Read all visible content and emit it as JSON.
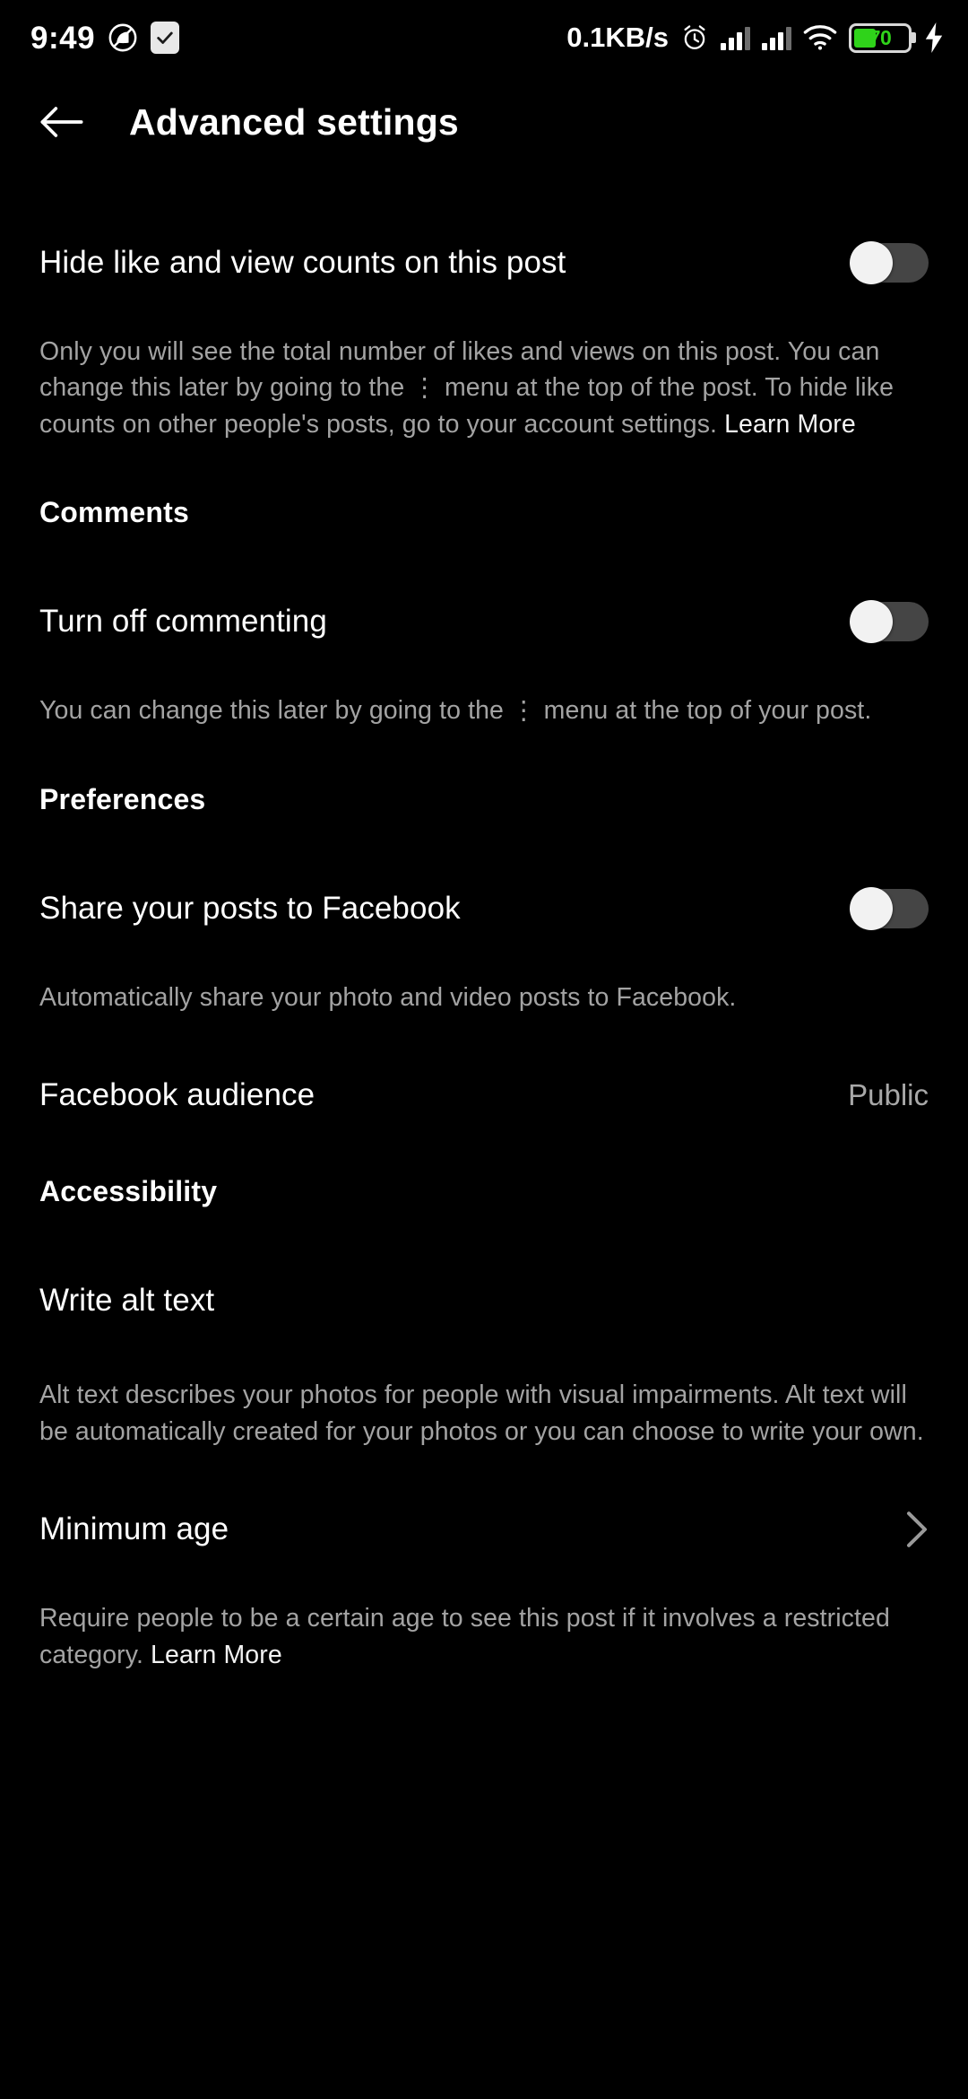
{
  "statusbar": {
    "time": "9:49",
    "network_speed": "0.1KB/s",
    "battery_percent": "70",
    "icons": {
      "dnd": "do-not-disturb-icon",
      "check_badge": "check-badge-icon",
      "alarm": "alarm-icon",
      "signal_1": "signal-bars-icon",
      "signal_2": "signal-bars-icon",
      "wifi": "wifi-icon",
      "battery": "battery-icon",
      "charging": "charging-bolt-icon"
    }
  },
  "header": {
    "back_icon": "back-arrow-icon",
    "title": "Advanced settings"
  },
  "hide_counts": {
    "label": "Hide like and view counts on this post",
    "toggle_state": "off",
    "description": "Only you will see the total number of likes and views on this post. You can change this later by going to the ⋮ menu at the top of the post. To hide like counts on other people's posts, go to your account settings. ",
    "link_label": "Learn More"
  },
  "comments": {
    "section_title": "Comments",
    "turn_off_label": "Turn off commenting",
    "toggle_state": "off",
    "description": "You can change this later by going to the ⋮ menu at the top of your post."
  },
  "preferences": {
    "section_title": "Preferences",
    "share_facebook_label": "Share your posts to Facebook",
    "share_toggle_state": "off",
    "share_description": "Automatically share your photo and video posts to Facebook.",
    "audience_label": "Facebook audience",
    "audience_value": "Public"
  },
  "accessibility": {
    "section_title": "Accessibility",
    "alt_text_label": "Write alt text",
    "alt_text_description": "Alt text describes your photos for people with visual impairments. Alt text will be automatically created for your photos or you can choose to write your own.",
    "minimum_age_label": "Minimum age",
    "minimum_age_chevron": "chevron-right-icon",
    "minimum_age_description": "Require people to be a certain age to see this post if it involves a restricted category. ",
    "minimum_age_link": "Learn More"
  },
  "colors": {
    "background": "#000000",
    "primary_text": "#ffffff",
    "secondary_text": "#a3a3a3",
    "toggle_track_off": "#454545",
    "toggle_thumb": "#f2f2f2",
    "battery_green": "#2fd31a"
  }
}
